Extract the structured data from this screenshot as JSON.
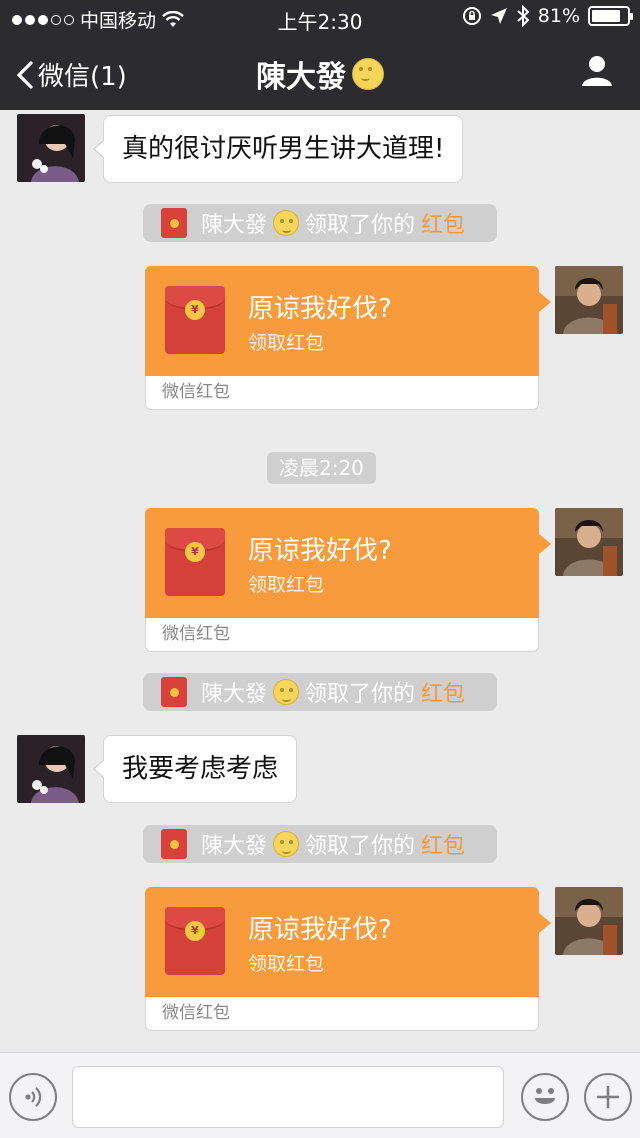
{
  "status_bar": {
    "carrier": "中国移动",
    "time": "上午2:30",
    "battery": "81%",
    "battery_level": 0.81
  },
  "nav": {
    "back_label": "微信(1)",
    "title": "陳大發"
  },
  "messages": {
    "m1_text": "真的很讨厌听男生讲大道理!",
    "note1": {
      "name": "陳大發",
      "action": "领取了你的",
      "highlight": "红包"
    },
    "rp1": {
      "title": "原谅我好伐?",
      "subtitle": "领取红包",
      "footer": "微信红包",
      "coin": "¥"
    },
    "timestamp": "凌晨2:20",
    "rp2": {
      "title": "原谅我好伐?",
      "subtitle": "领取红包",
      "footer": "微信红包",
      "coin": "¥"
    },
    "note2": {
      "name": "陳大發",
      "action": "领取了你的",
      "highlight": "红包"
    },
    "m2_text": "我要考虑考虑",
    "note3": {
      "name": "陳大發",
      "action": "领取了你的",
      "highlight": "红包"
    },
    "rp3": {
      "title": "原谅我好伐?",
      "subtitle": "领取红包",
      "footer": "微信红包",
      "coin": "¥"
    }
  },
  "input_bar": {
    "placeholder": ""
  },
  "icons": [
    "signal-dots-icon",
    "wifi-icon",
    "lock-rotation-icon",
    "location-arrow-icon",
    "bluetooth-icon",
    "battery-icon",
    "back-chevron-icon",
    "moon-emoji-icon",
    "person-icon",
    "voice-icon",
    "emoji-icon",
    "plus-icon"
  ],
  "colors": {
    "nav_bg": "#2c2c30",
    "chat_bg": "#ebebeb",
    "red_packet": "#f79b3c",
    "highlight": "#f5983a"
  }
}
